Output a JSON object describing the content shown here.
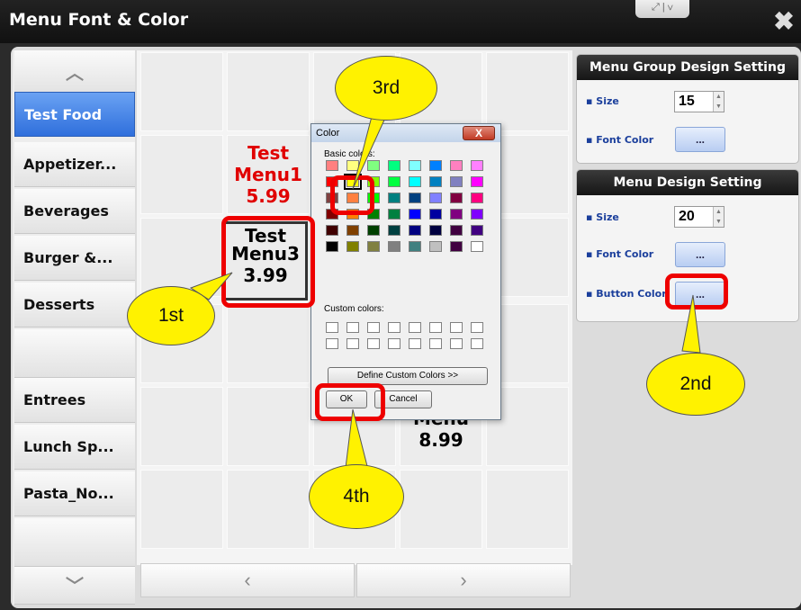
{
  "window": {
    "title": "Menu Font & Color",
    "close_glyph": "✖",
    "topctl": "⤢ | ∨"
  },
  "sidebar": {
    "up_arrow": "︿",
    "down_arrow": "﹀",
    "items": [
      {
        "label": "Test Food",
        "active": true
      },
      {
        "label": "Appetizer..."
      },
      {
        "label": "Beverages"
      },
      {
        "label": "Burger &..."
      },
      {
        "label": "Desserts"
      },
      {
        "label": ""
      },
      {
        "label": "Entrees"
      },
      {
        "label": "Lunch Sp..."
      },
      {
        "label": "Pasta_No..."
      }
    ]
  },
  "grid": {
    "item1": {
      "name": "Test",
      "name2": "Menu1",
      "price": "5.99",
      "color": "#e00000"
    },
    "item3": {
      "name": "Test",
      "name2": "Menu3",
      "price": "3.99"
    },
    "item_partial": {
      "name": "Menu",
      "price": "8.99"
    },
    "prev": "‹",
    "next": "›"
  },
  "group_settings": {
    "header": "Menu Group Design Setting",
    "size_label": "Size",
    "size_value": "15",
    "font_color_label": "Font Color",
    "button_label": "..."
  },
  "menu_settings": {
    "header": "Menu Design Setting",
    "size_label": "Size",
    "size_value": "20",
    "font_color_label": "Font Color",
    "button_color_label": "Button Color",
    "button_label": "..."
  },
  "color_dialog": {
    "title": "Color",
    "close": "X",
    "basic_colors_label": "Basic colors:",
    "custom_colors_label": "Custom colors:",
    "define_custom_button": "Define Custom Colors >>",
    "ok_button": "OK",
    "cancel_button": "Cancel",
    "basic_colors": [
      "#ff8080",
      "#ffff80",
      "#80ff80",
      "#00ff80",
      "#80ffff",
      "#0080ff",
      "#ff80c0",
      "#ff80ff",
      "#ff0000",
      "#ffff00",
      "#80ff00",
      "#00ff40",
      "#00ffff",
      "#0080c0",
      "#8080c0",
      "#ff00ff",
      "#804040",
      "#ff8040",
      "#00ff00",
      "#008080",
      "#004080",
      "#8080ff",
      "#800040",
      "#ff0080",
      "#800000",
      "#ff8000",
      "#008000",
      "#008040",
      "#0000ff",
      "#0000a0",
      "#800080",
      "#8000ff",
      "#400000",
      "#804000",
      "#004000",
      "#004040",
      "#000080",
      "#000040",
      "#400040",
      "#400080",
      "#000000",
      "#808000",
      "#808040",
      "#808080",
      "#408080",
      "#c0c0c0",
      "#400040",
      "#ffffff"
    ]
  },
  "callouts": {
    "first": "1st",
    "second": "2nd",
    "third": "3rd",
    "fourth": "4th"
  },
  "colors": {
    "highlight": "#e00000",
    "callout": "#fff200",
    "active_tab": "#2f6fdc"
  }
}
